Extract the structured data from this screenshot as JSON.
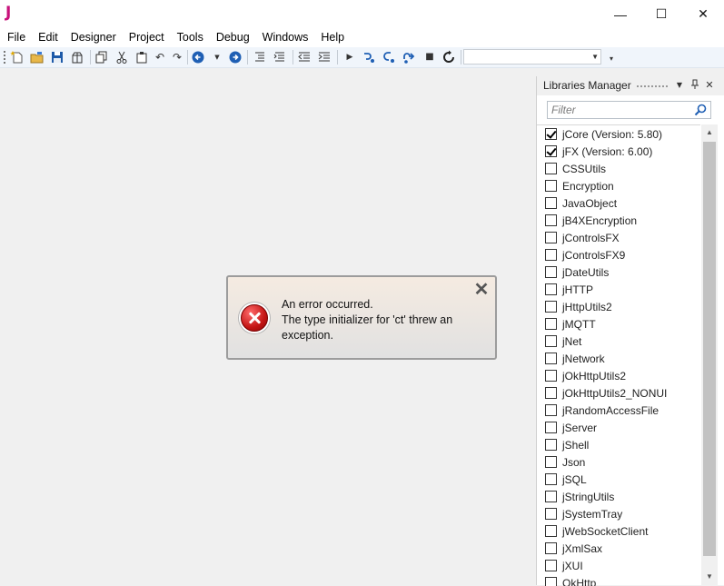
{
  "app": {
    "logo": "J"
  },
  "window_controls": {
    "minimize": "—",
    "maximize": "☐",
    "close": "✕"
  },
  "menu": [
    "File",
    "Edit",
    "Designer",
    "Project",
    "Tools",
    "Debug",
    "Windows",
    "Help"
  ],
  "error_dialog": {
    "line1": "An error occurred.",
    "line2": "The type initializer for 'ct' threw an exception."
  },
  "libraries_panel": {
    "title": "Libraries Manager",
    "filter_placeholder": "Filter",
    "items": [
      {
        "name": "jCore (Version: 5.80)",
        "checked": true
      },
      {
        "name": "jFX (Version: 6.00)",
        "checked": true
      },
      {
        "name": "CSSUtils",
        "checked": false
      },
      {
        "name": "Encryption",
        "checked": false
      },
      {
        "name": "JavaObject",
        "checked": false
      },
      {
        "name": "jB4XEncryption",
        "checked": false
      },
      {
        "name": "jControlsFX",
        "checked": false
      },
      {
        "name": "jControlsFX9",
        "checked": false
      },
      {
        "name": "jDateUtils",
        "checked": false
      },
      {
        "name": "jHTTP",
        "checked": false
      },
      {
        "name": "jHttpUtils2",
        "checked": false
      },
      {
        "name": "jMQTT",
        "checked": false
      },
      {
        "name": "jNet",
        "checked": false
      },
      {
        "name": "jNetwork",
        "checked": false
      },
      {
        "name": "jOkHttpUtils2",
        "checked": false
      },
      {
        "name": "jOkHttpUtils2_NONUI",
        "checked": false
      },
      {
        "name": "jRandomAccessFile",
        "checked": false
      },
      {
        "name": "jServer",
        "checked": false
      },
      {
        "name": "jShell",
        "checked": false
      },
      {
        "name": "Json",
        "checked": false
      },
      {
        "name": "jSQL",
        "checked": false
      },
      {
        "name": "jStringUtils",
        "checked": false
      },
      {
        "name": "jSystemTray",
        "checked": false
      },
      {
        "name": "jWebSocketClient",
        "checked": false
      },
      {
        "name": "jXmlSax",
        "checked": false
      },
      {
        "name": "jXUI",
        "checked": false
      },
      {
        "name": "OkHttp",
        "checked": false
      }
    ]
  }
}
